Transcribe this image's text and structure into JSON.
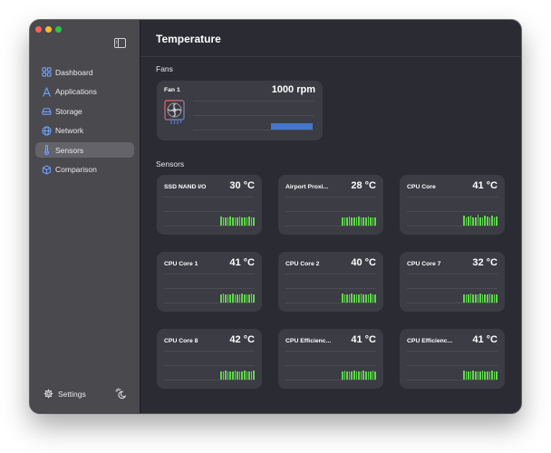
{
  "sidebar": {
    "items": [
      {
        "label": "Dashboard",
        "icon": "dashboard-icon",
        "active": false
      },
      {
        "label": "Applications",
        "icon": "applications-icon",
        "active": false
      },
      {
        "label": "Storage",
        "icon": "storage-icon",
        "active": false
      },
      {
        "label": "Network",
        "icon": "network-icon",
        "active": false
      },
      {
        "label": "Sensors",
        "icon": "sensors-icon",
        "active": true
      },
      {
        "label": "Comparison",
        "icon": "comparison-icon",
        "active": false
      }
    ],
    "settings_label": "Settings"
  },
  "main": {
    "title": "Temperature",
    "fans_label": "Fans",
    "sensors_label": "Sensors",
    "fans": [
      {
        "name": "Fan 1",
        "value": "1000 rpm",
        "bar_color": "#4676c8"
      }
    ],
    "sensors": [
      {
        "name": "SSD NAND I/O",
        "value": "30 °C"
      },
      {
        "name": "Airport Proxi...",
        "value": "28 °C"
      },
      {
        "name": "CPU Core",
        "value": "41 °C"
      },
      {
        "name": "CPU Core 1",
        "value": "41 °C"
      },
      {
        "name": "CPU Core 2",
        "value": "40 °C"
      },
      {
        "name": "CPU Core 7",
        "value": "32 °C"
      },
      {
        "name": "CPU Core 8",
        "value": "42 °C"
      },
      {
        "name": "CPU Efficienc...",
        "value": "41 °C"
      },
      {
        "name": "CPU Efficienc...",
        "value": "41 °C"
      }
    ]
  },
  "colors": {
    "accent_green": "#5ed84a",
    "accent_blue": "#4676c8",
    "window_bg": "#2a2b33",
    "sidebar_bg": "#4a494e",
    "card_bg": "#3b3c44"
  }
}
